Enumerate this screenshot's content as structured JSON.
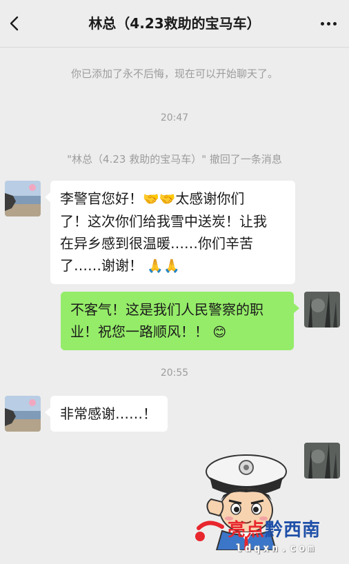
{
  "header": {
    "title": "林总（4.23救助的宝马车）",
    "back_icon": "chevron-left-icon",
    "more_icon": "more-dots-icon"
  },
  "chat": {
    "added_notice": "你已添加了永不后悔，现在可以开始聊天了。",
    "time_1": "20:47",
    "recall_notice": "\"林总（4.23 救助的宝马车）\" 撤回了一条消息",
    "messages": [
      {
        "sender": "contact",
        "lines": [
          "李警官您好！",
          "太感谢你们",
          "了！这次你们给我雪中送炭！让我",
          "在异乡感到很温暖……你们辛苦",
          "了……谢谢！"
        ]
      },
      {
        "sender": "me",
        "lines": [
          "不客气！这是我们人民警察的职",
          "业！祝您一路顺风！！"
        ]
      }
    ],
    "time_2": "20:55",
    "message_3": "非常感谢……！",
    "emoji_handshake": "🤝🤝",
    "emoji_pray": "🙏🙏",
    "emoji_smile": "😊"
  },
  "watermark": {
    "brand": "亮点黔西南",
    "url": "ldqxn.com"
  },
  "colors": {
    "background": "#ededed",
    "bubble_me": "#95ec69",
    "bubble_contact": "#ffffff",
    "system_text": "#9c9c9c"
  }
}
